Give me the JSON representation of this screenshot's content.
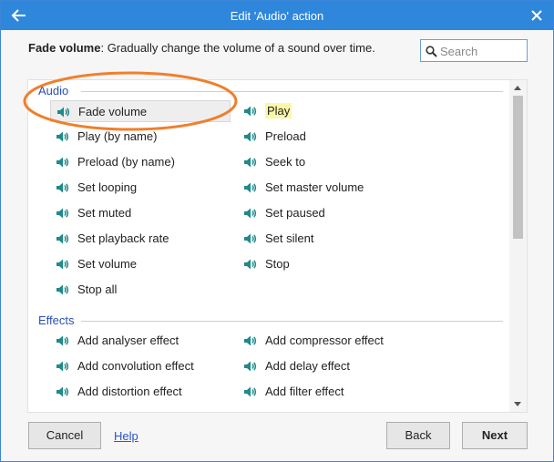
{
  "window": {
    "title": "Edit 'Audio' action"
  },
  "header": {
    "action_name": "Fade volume",
    "description": ": Gradually change the volume of a sound over time.",
    "search_placeholder": "Search"
  },
  "sections": [
    {
      "name": "Audio",
      "items": [
        {
          "label": "Fade volume",
          "selected": true
        },
        {
          "label": "Play",
          "highlighted": true
        },
        {
          "label": "Play (by name)"
        },
        {
          "label": "Preload"
        },
        {
          "label": "Preload (by name)"
        },
        {
          "label": "Seek to"
        },
        {
          "label": "Set looping"
        },
        {
          "label": "Set master volume"
        },
        {
          "label": "Set muted"
        },
        {
          "label": "Set paused"
        },
        {
          "label": "Set playback rate"
        },
        {
          "label": "Set silent"
        },
        {
          "label": "Set volume"
        },
        {
          "label": "Stop"
        },
        {
          "label": "Stop all"
        }
      ]
    },
    {
      "name": "Effects",
      "items": [
        {
          "label": "Add analyser effect"
        },
        {
          "label": "Add compressor effect"
        },
        {
          "label": "Add convolution effect"
        },
        {
          "label": "Add delay effect"
        },
        {
          "label": "Add distortion effect"
        },
        {
          "label": "Add filter effect"
        }
      ]
    }
  ],
  "footer": {
    "cancel_label": "Cancel",
    "help_label": "Help",
    "back_label": "Back",
    "next_label": "Next"
  },
  "icons": {
    "item_icon": "speaker-icon",
    "title_back": "back-arrow-icon",
    "title_close": "close-icon",
    "search": "search-icon"
  },
  "colors": {
    "titlebar": "#2f87dc",
    "section_heading": "#2c4fb8",
    "speaker_icon": "#1f8a8a",
    "highlight": "#fbf7a9",
    "annotation_ellipse": "#f07f2c"
  }
}
